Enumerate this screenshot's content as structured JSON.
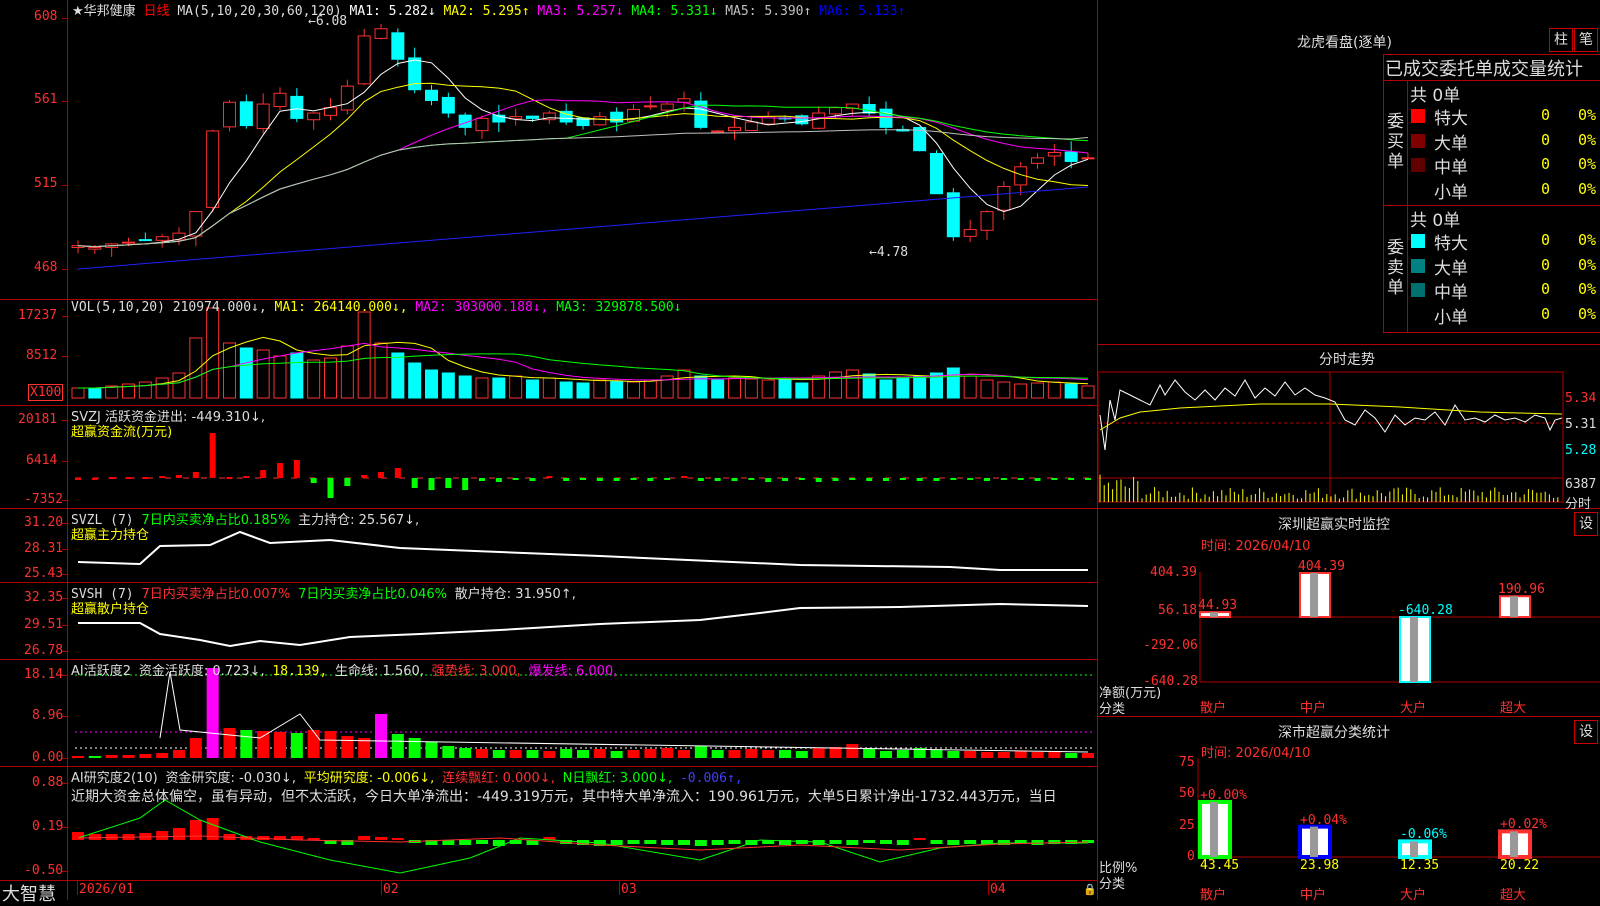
{
  "header": {
    "star": "★",
    "stock_name": "华邦健康",
    "period": "日线",
    "ma_params": "MA(5,10,20,30,60,120)",
    "ma_items": [
      {
        "label": "MA1: 5.282↓",
        "color": "#ffffff"
      },
      {
        "label": "MA2: 5.295↑",
        "color": "#ffff00"
      },
      {
        "label": "MA3: 5.257↓",
        "color": "#ff00ff"
      },
      {
        "label": "MA4: 5.331↓",
        "color": "#00ff00"
      },
      {
        "label": "MA5: 5.390↑",
        "color": "#c0c0c0"
      },
      {
        "label": "MA6: 5.133↑",
        "color": "#0000ff"
      }
    ]
  },
  "price_axis": [
    "608",
    "561",
    "515",
    "468"
  ],
  "price_annotations": {
    "high": "6.08",
    "low": "4.78"
  },
  "vol_panel": {
    "params": "VOL(5,10,20)",
    "value": "210974.000↓,",
    "ma1": "MA1: 264140.000↓,",
    "ma2": "MA2: 303000.188↓,",
    "ma3": "MA3: 329878.500↓",
    "axis": [
      "17237",
      "8512",
      "X100"
    ]
  },
  "svzj_panel": {
    "label": "SVZJ  活跃资金进出: -449.310↓,",
    "title": "超赢资金流(万元)",
    "axis": [
      "20181",
      "6414",
      "-7352"
    ]
  },
  "svzl_panel": {
    "params": "SVZL (7)",
    "ratio": "7日内买卖净占比0.185%",
    "hold": "主力持仓: 25.567↓,",
    "title": "超赢主力持仓",
    "axis": [
      "31.20",
      "28.31",
      "25.43"
    ]
  },
  "svsh_panel": {
    "params": "SVSH (7)",
    "ratio1": "7日内买卖净占比0.007%",
    "ratio2": "7日内买卖净占比0.046%",
    "hold": "散户持仓: 31.950↑,",
    "axis": [
      "32.35",
      "29.51",
      "26.78"
    ],
    "title": "超赢散户持仓"
  },
  "ai_active_panel": {
    "params": "AI活跃度2",
    "active": "资金活跃度: 0.723↓,",
    "v2": "18.139,",
    "life": "生命线: 1.560,",
    "strong": "强势线: 3.000,",
    "burst": "爆发线: 6.000,",
    "axis": [
      "18.14",
      "8.96",
      "0.00"
    ]
  },
  "ai_research_panel": {
    "params": "AI研究度2(10)",
    "research": "资金研究度: -0.030↓,",
    "avg": "平均研究度: -0.006↓,",
    "red": "连续飘红: 0.000↓,",
    "nred": "N日飘红: 3.000↓,",
    "last": "-0.006↑,",
    "axis": [
      "0.88",
      "0.19",
      "-0.50"
    ],
    "summary": "近期大资金总体偏空，虽有异动，但不太活跃，今日大单净流出：-449.319万元，其中特大单净流入：190.961万元，大单5日累计净出-1732.443万元，当日"
  },
  "bottom_bar": {
    "logo": "大智慧",
    "dates": [
      "2026/01",
      "02",
      "03",
      "04"
    ]
  },
  "dragon_panel": {
    "title": "龙虎看盘(逐单)",
    "btn1": "柱",
    "btn2": "笔",
    "subtitle": "已成交委托单成交量统计",
    "buy": {
      "side": "委买单",
      "total": "共 0单",
      "rows": [
        {
          "label": "特大",
          "count": "0",
          "pct": "0%",
          "color": "#ff0000"
        },
        {
          "label": "大单",
          "count": "0",
          "pct": "0%",
          "color": "#800000"
        },
        {
          "label": "中单",
          "count": "0",
          "pct": "0%",
          "color": "#600000"
        },
        {
          "label": "小单",
          "count": "0",
          "pct": "0%",
          "color": "#000000"
        }
      ]
    },
    "sell": {
      "side": "委卖单",
      "total": "共 0单",
      "rows": [
        {
          "label": "特大",
          "count": "0",
          "pct": "0%",
          "color": "#00ffff"
        },
        {
          "label": "大单",
          "count": "0",
          "pct": "0%",
          "color": "#008080"
        },
        {
          "label": "中单",
          "count": "0",
          "pct": "0%",
          "color": "#007070"
        },
        {
          "label": "小单",
          "count": "0",
          "pct": "0%",
          "color": "#000000"
        }
      ]
    }
  },
  "intraday_panel": {
    "title": "分时走势",
    "axis": [
      "5.34",
      "5.31",
      "5.28"
    ],
    "vol": "6387",
    "vol_label": "分时"
  },
  "monitor_panel": {
    "title": "深圳超赢实时监控",
    "btn": "设",
    "time": "时间: 2026/04/10",
    "axis": [
      "404.39",
      "56.18",
      "-292.06",
      "-640.28"
    ],
    "ylabel": "净额(万元)",
    "xlabel": "分类",
    "categories": [
      "散户",
      "中户",
      "大户",
      "超大"
    ],
    "values": [
      44.93,
      404.39,
      -640.28,
      190.96
    ],
    "value_labels": [
      "44.93",
      "404.39",
      "-640.28",
      "190.96"
    ]
  },
  "classify_panel": {
    "title": "深市超赢分类统计",
    "btn": "设",
    "time": "时间: 2026/04/10",
    "axis": [
      "75",
      "50",
      "25",
      "0"
    ],
    "ylabel": "比例%",
    "xlabel": "分类",
    "categories": [
      "散户",
      "中户",
      "大户",
      "超大"
    ],
    "values": [
      43.45,
      23.98,
      12.35,
      20.22
    ],
    "value_labels": [
      "43.45",
      "23.98",
      "12.35",
      "20.22"
    ],
    "changes": [
      "+0.00%",
      "+0.04%",
      "-0.06%",
      "+0.02%"
    ]
  }
}
